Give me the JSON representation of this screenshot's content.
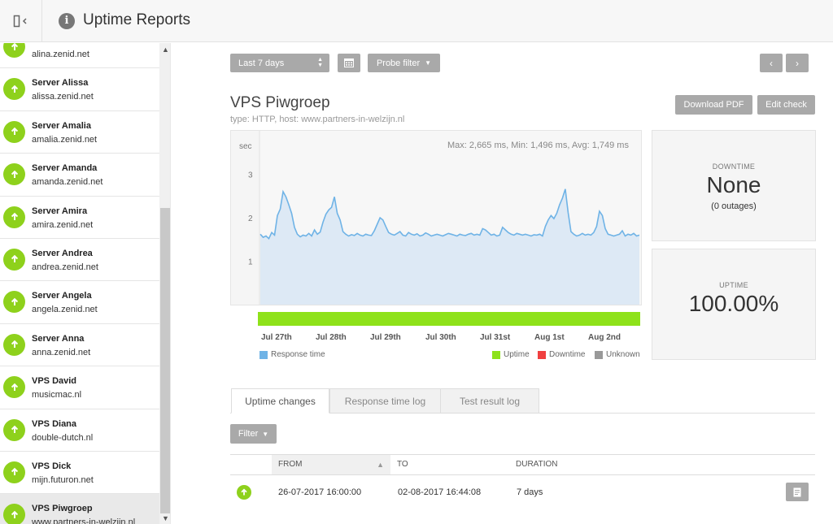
{
  "header": {
    "title": "Uptime Reports",
    "info_icon": "i"
  },
  "sidebar": {
    "servers": [
      {
        "name": "",
        "host": "alina.zenid.net",
        "status": "up"
      },
      {
        "name": "Server Alissa",
        "host": "alissa.zenid.net",
        "status": "up"
      },
      {
        "name": "Server Amalia",
        "host": "amalia.zenid.net",
        "status": "up"
      },
      {
        "name": "Server Amanda",
        "host": "amanda.zenid.net",
        "status": "up"
      },
      {
        "name": "Server Amira",
        "host": "amira.zenid.net",
        "status": "up"
      },
      {
        "name": "Server Andrea",
        "host": "andrea.zenid.net",
        "status": "up"
      },
      {
        "name": "Server Angela",
        "host": "angela.zenid.net",
        "status": "up"
      },
      {
        "name": "Server Anna",
        "host": "anna.zenid.net",
        "status": "up"
      },
      {
        "name": "VPS David",
        "host": "musicmac.nl",
        "status": "up"
      },
      {
        "name": "VPS Diana",
        "host": "double-dutch.nl",
        "status": "up"
      },
      {
        "name": "VPS Dick",
        "host": "mijn.futuron.net",
        "status": "up"
      },
      {
        "name": "VPS Piwgroep",
        "host": "www.partners-in-welzijn.nl",
        "status": "up",
        "active": true
      }
    ]
  },
  "toolbar": {
    "range_label": "Last 7 days",
    "probe_label": "Probe filter",
    "download_label": "Download PDF",
    "edit_label": "Edit check",
    "prev_icon": "‹",
    "next_icon": "›"
  },
  "check": {
    "title": "VPS Piwgroep",
    "subtitle": "type: HTTP, host: www.partners-in-welzijn.nl"
  },
  "chart_data": {
    "type": "area",
    "ylabel": "sec",
    "yticks": [
      "1",
      "2",
      "3"
    ],
    "ylim": [
      0,
      4
    ],
    "summary": "Max: 2,665 ms, Min: 1,496 ms, Avg: 1,749 ms",
    "x_ticks": [
      "Jul 27th",
      "Jul 28th",
      "Jul 29th",
      "Jul 30th",
      "Jul 31st",
      "Aug 1st",
      "Aug 2nd"
    ],
    "series": [
      {
        "name": "Response time",
        "color": "#6fb3e6",
        "values": [
          1.62,
          1.55,
          1.58,
          1.52,
          1.66,
          1.6,
          2.05,
          2.2,
          2.6,
          2.48,
          2.3,
          2.1,
          1.78,
          1.62,
          1.56,
          1.6,
          1.58,
          1.64,
          1.58,
          1.72,
          1.62,
          1.67,
          1.9,
          2.08,
          2.18,
          2.24,
          2.48,
          2.1,
          1.95,
          1.68,
          1.62,
          1.58,
          1.61,
          1.59,
          1.64,
          1.6,
          1.58,
          1.62,
          1.6,
          1.59,
          1.7,
          1.85,
          2.0,
          1.95,
          1.8,
          1.66,
          1.62,
          1.6,
          1.64,
          1.68,
          1.6,
          1.58,
          1.66,
          1.62,
          1.6,
          1.63,
          1.58,
          1.6,
          1.65,
          1.62,
          1.58,
          1.6,
          1.62,
          1.6,
          1.58,
          1.61,
          1.64,
          1.62,
          1.6,
          1.58,
          1.62,
          1.6,
          1.59,
          1.62,
          1.64,
          1.6,
          1.62,
          1.6,
          1.75,
          1.72,
          1.66,
          1.6,
          1.62,
          1.58,
          1.6,
          1.78,
          1.72,
          1.66,
          1.62,
          1.6,
          1.64,
          1.62,
          1.6,
          1.62,
          1.6,
          1.58,
          1.61,
          1.6,
          1.62,
          1.58,
          1.8,
          1.95,
          2.05,
          1.98,
          2.1,
          2.3,
          2.45,
          2.66,
          2.12,
          1.68,
          1.62,
          1.58,
          1.6,
          1.64,
          1.6,
          1.62,
          1.6,
          1.66,
          1.8,
          2.15,
          2.05,
          1.75,
          1.62,
          1.6,
          1.58,
          1.6,
          1.62,
          1.7,
          1.58,
          1.62,
          1.6,
          1.64,
          1.58,
          1.6
        ]
      }
    ],
    "uptime_series": {
      "name": "Uptime",
      "color": "#8ee21a",
      "value_percent": 100
    },
    "legend": [
      {
        "label": "Response time",
        "color": "#6fb3e6"
      },
      {
        "label": "Uptime",
        "color": "#8ee21a"
      },
      {
        "label": "Downtime",
        "color": "#f04040"
      },
      {
        "label": "Unknown",
        "color": "#999999"
      }
    ]
  },
  "stats": {
    "downtime": {
      "label": "DOWNTIME",
      "value": "None",
      "sub": "(0 outages)"
    },
    "uptime": {
      "label": "UPTIME",
      "value": "100.00%"
    }
  },
  "tabs": [
    {
      "label": "Uptime changes",
      "active": true
    },
    {
      "label": "Response time log",
      "active": false
    },
    {
      "label": "Test result log",
      "active": false
    }
  ],
  "filter_label": "Filter",
  "table": {
    "columns": [
      "FROM",
      "TO",
      "DURATION"
    ],
    "rows": [
      {
        "status": "up",
        "from": "26-07-2017 16:00:00",
        "to": "02-08-2017 16:44:08",
        "duration": "7 days"
      }
    ]
  }
}
